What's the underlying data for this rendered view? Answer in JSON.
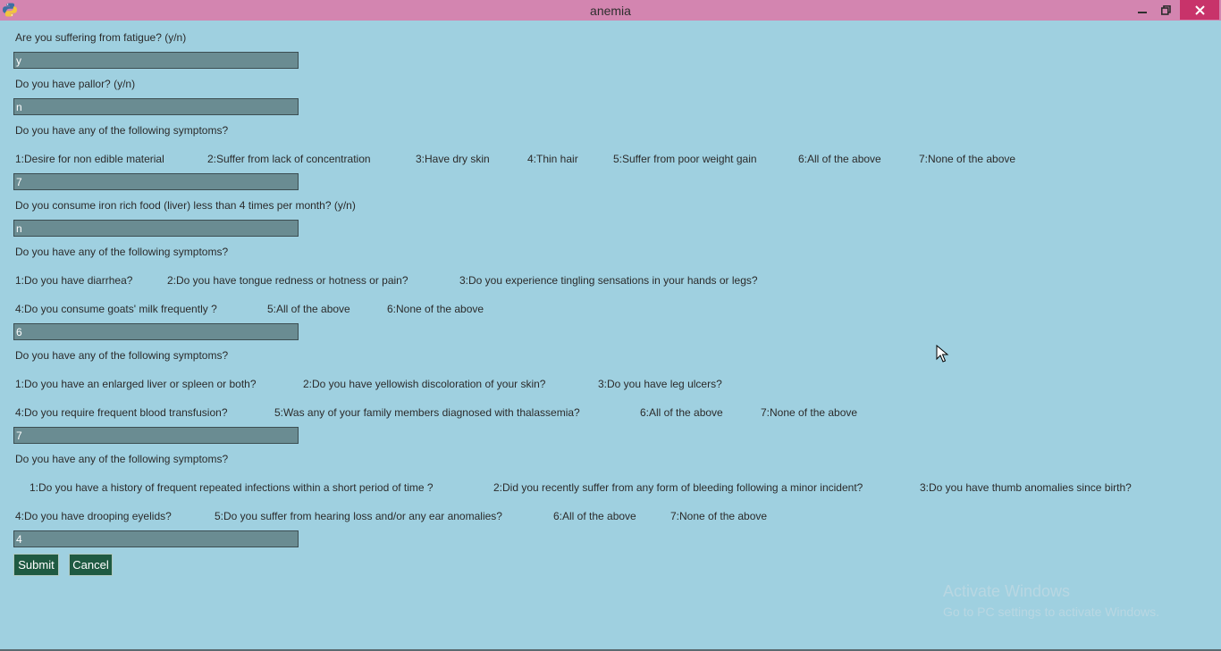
{
  "window": {
    "title": "anemia",
    "controls": {
      "minimize_icon": "minimize-icon",
      "maximize_icon": "restore-icon",
      "close_icon": "close-icon"
    },
    "colors": {
      "titlebar": "#d385b0",
      "background": "#9fd0e0",
      "close": "#c8336a",
      "entry": "#6a8c92",
      "button": "#1f5a42"
    }
  },
  "form": {
    "q1": {
      "label": "Are you suffering from fatigue? (y/n)",
      "value": "y"
    },
    "q2": {
      "label": "Do you have pallor? (y/n)",
      "value": "n"
    },
    "q3": {
      "label": "Do you have any of the following symptoms?",
      "options": [
        "1:Desire for non edible material",
        "2:Suffer from lack of concentration",
        "3:Have dry skin",
        "4:Thin hair",
        "5:Suffer from poor weight gain",
        "6:All of the above",
        "7:None of the above"
      ],
      "value": "7"
    },
    "q4": {
      "label": "Do you consume iron rich food (liver) less than 4 times per month? (y/n)",
      "value": "n"
    },
    "q5": {
      "label": "Do you have any of the following symptoms?",
      "options_row1": [
        "1:Do you have diarrhea?",
        "2:Do you have tongue redness or hotness or pain?",
        "3:Do you experience tingling sensations in your hands or legs?"
      ],
      "options_row2": [
        "4:Do you consume goats' milk frequently ?",
        "5:All of the above",
        "6:None of the above"
      ],
      "value": "6"
    },
    "q6": {
      "label": "Do you have any of the following symptoms?",
      "options_row1": [
        "1:Do you have an enlarged liver or spleen or both?",
        "2:Do you have yellowish discoloration of your skin?",
        "3:Do you have leg ulcers?"
      ],
      "options_row2": [
        "4:Do you require frequent blood transfusion?",
        "5:Was any of your family members diagnosed with thalassemia?",
        "6:All of the above",
        "7:None of the above"
      ],
      "value": "7"
    },
    "q7": {
      "label": "Do you have any of the following symptoms?",
      "options_row1": [
        "1:Do you have a history of frequent repeated infections within a short period of time ?",
        "2:Did you recently suffer from any form of bleeding following a minor incident?",
        "3:Do you have thumb anomalies since birth?"
      ],
      "options_row2": [
        "4:Do you have drooping eyelids?",
        "5:Do you suffer from hearing loss and/or any ear anomalies?",
        "6:All of the above",
        "7:None of the above"
      ],
      "value": "4"
    },
    "submit_label": "Submit",
    "cancel_label": "Cancel"
  },
  "watermark": {
    "title": "Activate Windows",
    "subtitle": "Go to PC settings to activate Windows."
  }
}
